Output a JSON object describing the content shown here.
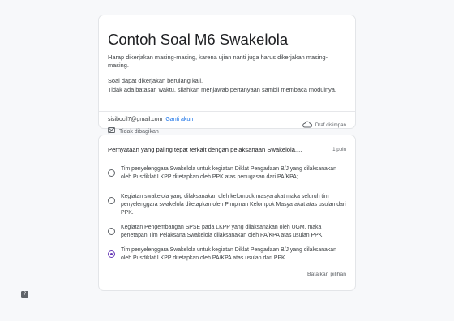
{
  "form": {
    "title": "Contoh Soal M6 Swakelola",
    "description": [
      "Harap dikerjakan masing-masing, karena ujian nanti juga harus dikerjakan masing-masing.",
      "Soal dapat dikerjakan berulang kali.",
      "Tidak ada batasan waktu, silahkan menjawab pertanyaan sambil membaca modulnya."
    ]
  },
  "account": {
    "email": "sisibocil7@gmail.com",
    "switch_label": "Ganti akun",
    "share_status": "Tidak dibagikan",
    "draft_status": "Draf disimpan"
  },
  "question": {
    "text": "Pernyataan yang paling tepat terkait dengan pelaksanaan Swakelola....",
    "points": "1 poin",
    "selected_option_index": 3,
    "options": [
      "Tim penyelenggara Swakelola untuk kegiatan Diklat Pengadaan B/J yang dilaksanakan oleh Pusdiklat LKPP ditetapkan oleh PPK atas penugasan dari PA/KPA;",
      "Kegiatan swakelola yang dilaksanakan oleh kelompok masyarakat maka seluruh tim penyelenggara swakelola ditetapkan oleh Pimpinan Kelompok Masyarakat atas usulan dari PPK.",
      "Kegiatan Pengembangan SPSE pada LKPP yang dilaksanakan oleh UGM, maka penetapan Tim Pelaksana Swakelola dilaksanakan oleh PA/KPA atas usulan PPK",
      "Tim penyelenggara Swakelola untuk kegiatan Diklat Pengadaan B/J yang dilaksanakan oleh Pusdiklat LKPP ditetapkan oleh PA/KPA atas usulan dari PPK"
    ],
    "clear_label": "Batalkan pilihan"
  },
  "help_label": "?"
}
